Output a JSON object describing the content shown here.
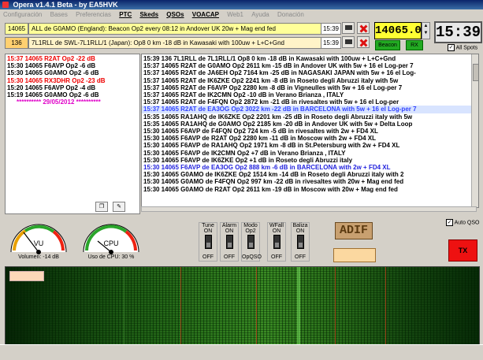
{
  "window": {
    "title": "Opera v1.4.1 Beta  -  by EA5HVK"
  },
  "menu": [
    "Configuración",
    "Bases",
    "Preferencias",
    "PTC",
    "Skeds",
    "QSOs",
    "VOACAP",
    "Web1",
    "Ayuda",
    "Donación"
  ],
  "active_menu": [
    "PTC",
    "Skeds",
    "QSOs",
    "VOACAP"
  ],
  "messages": [
    {
      "freq": "14065",
      "text": "ALL de G0AMO (England): Beacon Op2 every 08:12 in Andover UK 20w + Mag end fed",
      "time": "15:39",
      "bg": "#ffff99"
    },
    {
      "freq": "136",
      "text": "7L1RLL de SWL-7L1RLL/1 (Japan): Op8 0 km -18 dB in Kawasaki with 100uw + L+C+Gnd",
      "time": "15:39",
      "bg": "#fff3c8"
    }
  ],
  "frequency": "14065.0",
  "clock": "15:39",
  "beacon_btn": "Beacon",
  "rx_btn": "RX",
  "all_spots": "All Spots",
  "left_log": [
    {
      "text": "15:37 14065 R2AT Op2 -22 dB",
      "cls": "red"
    },
    {
      "text": "15:30 14065 F6AVP Op2 -6 dB",
      "cls": ""
    },
    {
      "text": "15:30 14065 G0AMO Op2 -6 dB",
      "cls": ""
    },
    {
      "text": "15:30 14065 RX3DHR Op2 -23 dB",
      "cls": "red"
    },
    {
      "text": "15:20 14065 F6AVP Op2 -4 dB",
      "cls": ""
    },
    {
      "text": "15:19 14065 G0AMO Op2 -6 dB",
      "cls": ""
    },
    {
      "text": "**********  29/05/2012  **********",
      "cls": "pink"
    }
  ],
  "right_log": [
    {
      "text": "15:39      136 7L1RLL de 7L1RLL/1 Op8 0 km -18 dB in Kawasaki with 100uw + L+C+Gnd",
      "cls": ""
    },
    {
      "text": "15:37 14065 R2AT de G0AMO Op2 2611 km -15 dB in Andover UK with 5w + 16 el Log-per 7",
      "cls": ""
    },
    {
      "text": "15:37 14065 R2AT de JA6EH Op2 7164 km -25 dB in NAGASAKI JAPAN with 5w + 16 el Log-",
      "cls": ""
    },
    {
      "text": "15:37 14065 R2AT de IK6ZKE Op2 2241 km -8 dB in Roseto degli Abruzzi italy with 5w",
      "cls": ""
    },
    {
      "text": "15:37 14065 R2AT de F6AVP Op2 2280 km -8 dB in Vigneulles with 5w + 16 el Log-per 7",
      "cls": ""
    },
    {
      "text": "15:37 14065 R2AT de IK2CMN Op2  -10 dB in Verano Brianza , ITALY",
      "cls": ""
    },
    {
      "text": "15:37 14065 R2AT de F4FQN Op2 2872 km -21 dB in rivesaltes with 5w + 16 el Log-per",
      "cls": ""
    },
    {
      "text": "15:37 14065 R2AT de EA3OG Op2 3022 km -22 dB in BARCELONA with 5w + 16 el Log-per 7",
      "cls": "hl"
    },
    {
      "text": "15:35 14065 RA1AHQ de IK6ZKE Op2 2201 km -25 dB in Roseto degli Abruzzi italy with 5w",
      "cls": ""
    },
    {
      "text": "15:35 14065 RA1AHQ de G0AMO Op2 2185 km -20 dB in Andover UK with 5w + Delta Loop",
      "cls": ""
    },
    {
      "text": "15:30 14065 F6AVP de F4FQN Op2 724 km -5 dB in rivesaltes with 2w + FD4 XL",
      "cls": ""
    },
    {
      "text": "15:30 14065 F6AVP de R2AT Op2 2280 km -11 dB in Moscow with 2w + FD4 XL",
      "cls": ""
    },
    {
      "text": "15:30 14065 F6AVP de RA1AHQ Op2 1971 km -8 dB in St.Petersburg with 2w + FD4 XL",
      "cls": ""
    },
    {
      "text": "15:30 14065 F6AVP de IK2CMN Op2  +7 dB in Verano Brianza , ITALY",
      "cls": ""
    },
    {
      "text": "15:30 14065 F6AVP de IK6ZKE Op2  +1 dB in Roseto degli Abruzzi italy",
      "cls": ""
    },
    {
      "text": "15:30 14065 F6AVP de EA3OG Op2 888 km -6 dB in BARCELONA with 2w + FD4 XL",
      "cls": "blue"
    },
    {
      "text": "15:30 14065 G0AMO de IK6ZKE Op2 1514 km -14 dB in Roseto degli Abruzzi italy with 2",
      "cls": ""
    },
    {
      "text": "15:30 14065 G0AMO de F4FQN Op2 997 km -22 dB in rivesaltes with 20w + Mag end fed",
      "cls": ""
    },
    {
      "text": "15:30 14065 G0AMO de R2AT Op2 2611 km -19 dB in Moscow with 20w + Mag end fed",
      "cls": ""
    }
  ],
  "vu": {
    "label": "VU",
    "caption": "Volumen: -14 dB"
  },
  "cpu": {
    "label": "CPU",
    "caption": "Uso de CPU: 30 %"
  },
  "toggles": [
    {
      "top": "Tune",
      "mid": "ON",
      "bot": "OFF"
    },
    {
      "top": "Alarm",
      "mid": "ON",
      "bot": "OFF"
    },
    {
      "top": "Modo",
      "mid": "Op2",
      "bot": "OpQSO"
    },
    {
      "top": "WFall",
      "mid": "ON",
      "bot": "OFF"
    },
    {
      "top": "Baliza",
      "mid": "ON",
      "bot": "OFF"
    }
  ],
  "adif": "ADIF",
  "auto_qso": "Auto QSO",
  "tx": "TX"
}
